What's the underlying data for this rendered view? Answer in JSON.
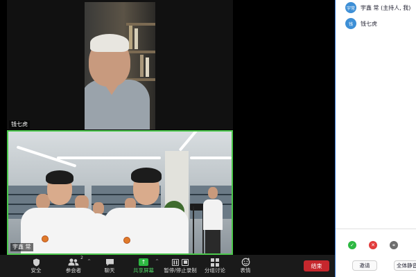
{
  "videos": {
    "top_name": "钱七虎",
    "bottom_name": "宇鑫 常"
  },
  "participants": [
    {
      "avatar": "宇常",
      "name": "宇鑫 常 (主持人, 我)",
      "avatar_color": "#3d8fd6"
    },
    {
      "avatar": "钱",
      "name": "钱七虎",
      "avatar_color": "#3d8fd6"
    }
  ],
  "panel": {
    "invite_label": "邀请",
    "mute_all_label": "全体静音",
    "reactions": [
      {
        "icon": "check-icon",
        "glyph": "✓"
      },
      {
        "icon": "cross-icon",
        "glyph": "✕"
      },
      {
        "icon": "rewind-icon",
        "glyph": "«"
      }
    ]
  },
  "toolbar": {
    "security": "安全",
    "participants": "参会者",
    "participant_count": "2",
    "chat": "聊天",
    "share": "共享屏幕",
    "record": "暂停/停止录制",
    "breakout": "分组讨论",
    "reactions": "表情",
    "end": "结束"
  },
  "colors": {
    "accent_green": "#2db842",
    "end_red": "#c6272d",
    "panel_border": "#3a7bd5",
    "active_speaker": "#4cc94c"
  }
}
